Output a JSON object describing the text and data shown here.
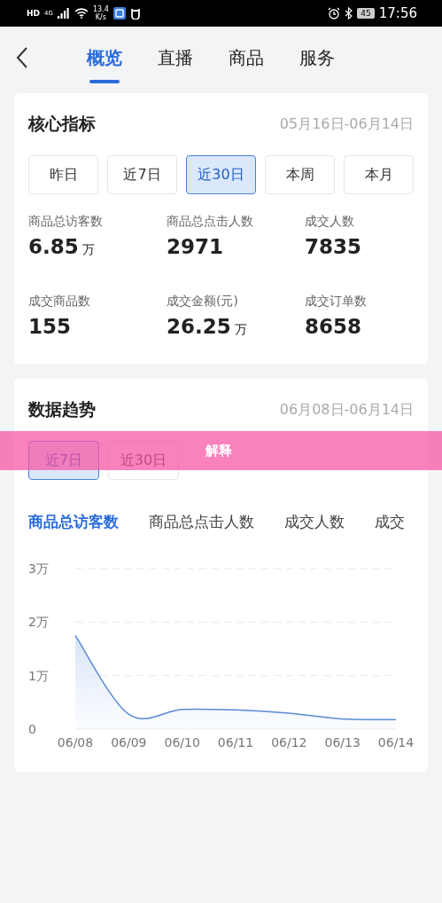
{
  "status_bar": {
    "left": [
      "HD",
      "4G"
    ],
    "speed": [
      "13.4",
      "K/s"
    ],
    "battery": "45",
    "time": "17:56"
  },
  "nav": {
    "tabs": [
      {
        "label": "概览",
        "selected": true
      },
      {
        "label": "直播",
        "selected": false
      },
      {
        "label": "商品",
        "selected": false
      },
      {
        "label": "服务",
        "selected": false
      }
    ]
  },
  "core_metrics": {
    "title": "核心指标",
    "date_range": "05月16日-06月14日",
    "periods": [
      {
        "label": "昨日",
        "selected": false
      },
      {
        "label": "近7日",
        "selected": false
      },
      {
        "label": "近30日",
        "selected": true
      },
      {
        "label": "本周",
        "selected": false
      },
      {
        "label": "本月",
        "selected": false
      }
    ],
    "metrics": [
      {
        "label": "商品总访客数",
        "value": "6.85",
        "unit": "万"
      },
      {
        "label": "商品总点击人数",
        "value": "2971"
      },
      {
        "label": "成交人数",
        "value": "7835"
      },
      {
        "label": "成交商品数",
        "value": "155"
      },
      {
        "label": "成交金额(元)",
        "value": "26.25",
        "unit": "万"
      },
      {
        "label": "成交订单数",
        "value": "8658"
      }
    ]
  },
  "trend": {
    "title": "数据趋势",
    "date_range": "06月08日-06月14日",
    "periods": [
      {
        "label": "近7日",
        "selected": true
      },
      {
        "label": "近30日",
        "selected": false
      }
    ],
    "metric_tabs": [
      {
        "label": "商品总访客数",
        "selected": true
      },
      {
        "label": "商品总点击人数",
        "selected": false
      },
      {
        "label": "成交人数",
        "selected": false
      },
      {
        "label": "成交",
        "selected": false
      }
    ],
    "chart_data": {
      "type": "area",
      "categories": [
        "06/08",
        "06/09",
        "06/10",
        "06/11",
        "06/12",
        "06/13",
        "06/14"
      ],
      "series": [
        {
          "color": "#5b8ad6",
          "values": [
            1.75,
            0.28,
            0.37,
            0.36,
            0.3,
            0.19,
            0.18
          ]
        }
      ],
      "ylim": [
        0,
        3
      ],
      "yticks": [
        {
          "value": 0,
          "label": "0"
        },
        {
          "value": 1,
          "label": "1万"
        },
        {
          "value": 2,
          "label": "2万"
        },
        {
          "value": 3,
          "label": "3万"
        }
      ]
    }
  },
  "overlay": {
    "label": "解释"
  }
}
